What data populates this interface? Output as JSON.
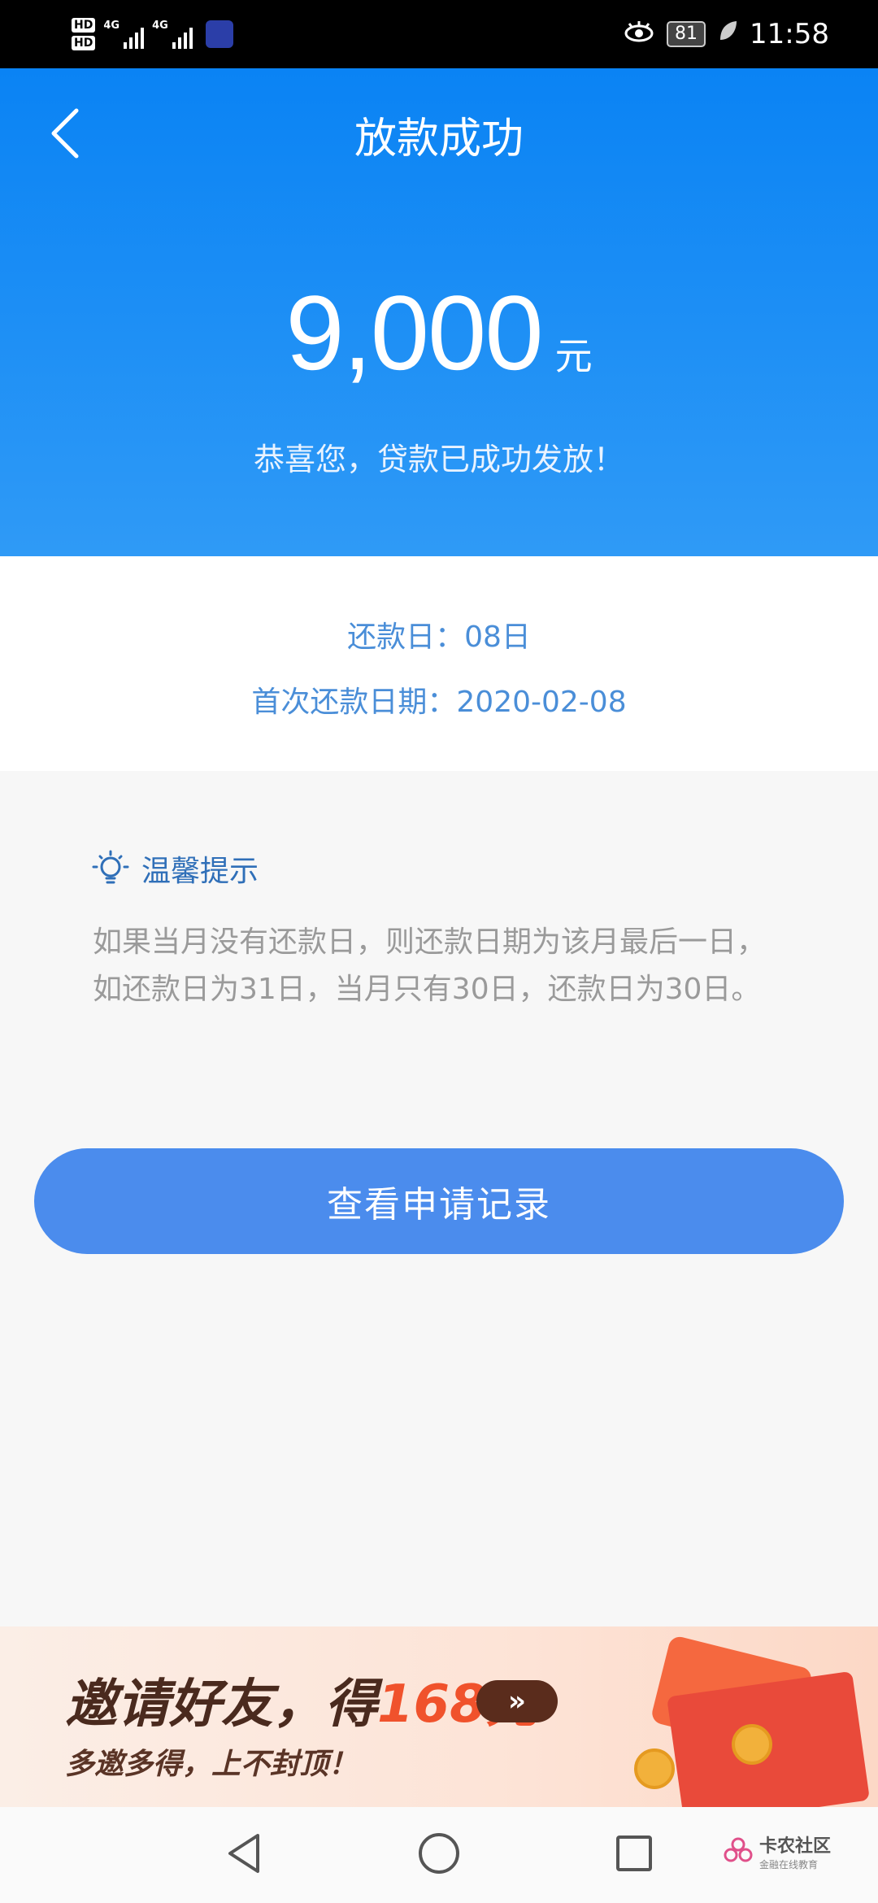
{
  "status_bar": {
    "hd1": "HD",
    "hd2": "HD",
    "net1": "4G",
    "net2": "4G",
    "battery": "81",
    "time": "11:58"
  },
  "header": {
    "title": "放款成功",
    "amount": "9,000",
    "unit": "元",
    "message": "恭喜您，贷款已成功发放！"
  },
  "info": {
    "repay_day": "还款日：08日",
    "first_repay_date": "首次还款日期：2020-02-08"
  },
  "tip": {
    "title": "温馨提示",
    "text": "如果当月没有还款日，则还款日期为该月最后一日，如还款日为31日，当月只有30日，还款日为30日。"
  },
  "button": {
    "label": "查看申请记录"
  },
  "banner": {
    "headline_prefix": "邀请好友，得",
    "headline_amount": "168元",
    "subline": "多邀多得，上不封顶！",
    "arrow": "»"
  },
  "watermark": {
    "main": "卡农社区",
    "sub": "金融在线教育"
  },
  "colors": {
    "header_blue": "#0a83f4",
    "button_blue": "#4b8ced",
    "info_text": "#4a8ed8"
  }
}
